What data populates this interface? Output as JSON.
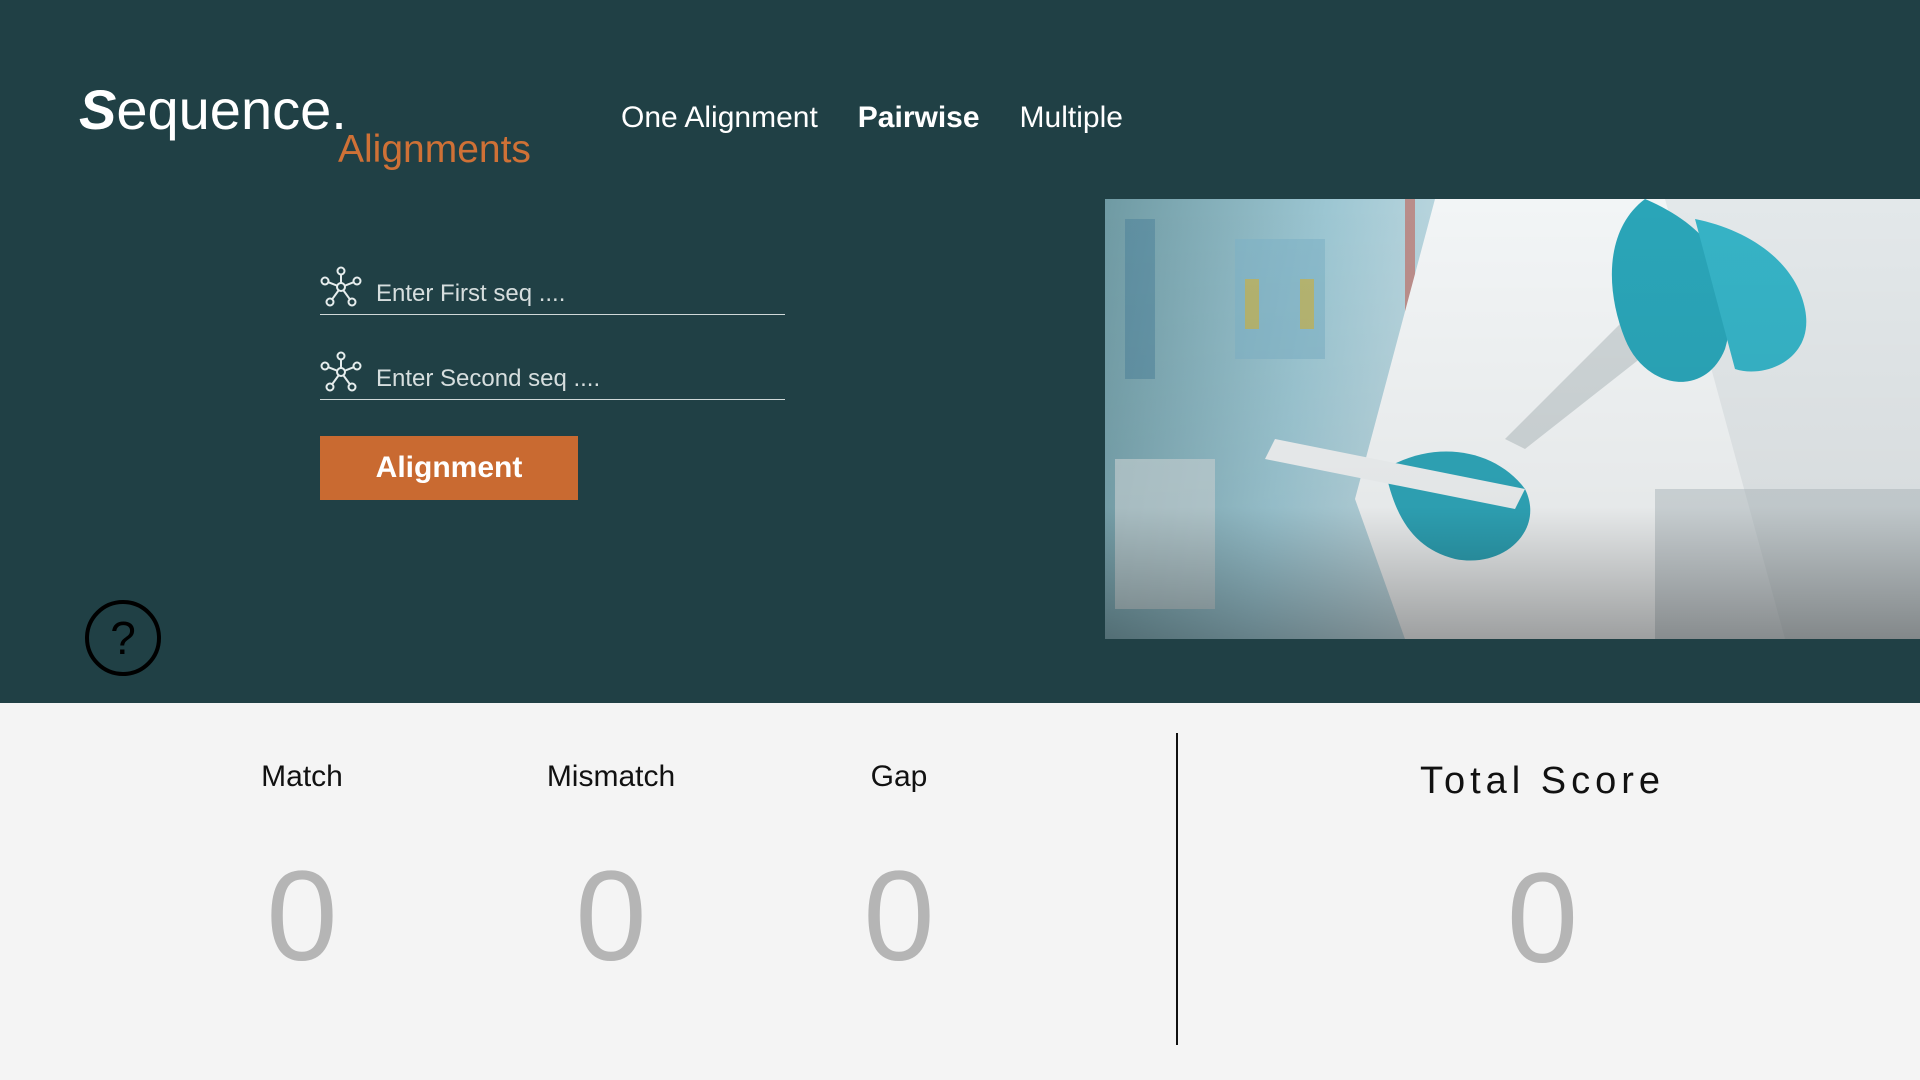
{
  "brand": {
    "title_initial": "S",
    "title_rest": "equence.",
    "subtitle": "Alignments"
  },
  "nav": {
    "items": [
      {
        "label": "One Alignment"
      },
      {
        "label": "Pairwise"
      },
      {
        "label": "Multiple"
      }
    ],
    "active": "Pairwise"
  },
  "form": {
    "first_seq": {
      "value": "",
      "placeholder": "Enter First seq ...."
    },
    "second_seq": {
      "value": "",
      "placeholder": "Enter Second seq ...."
    },
    "submit_label": "Alignment"
  },
  "help": {
    "glyph": "?"
  },
  "stats": {
    "match": {
      "label": "Match",
      "value": "0"
    },
    "mismatch": {
      "label": "Mismatch",
      "value": "0"
    },
    "gap": {
      "label": "Gap",
      "value": "0"
    }
  },
  "total": {
    "label": "Total Score",
    "value": "0"
  },
  "colors": {
    "hero_bg": "#204045",
    "accent": "#c96a31",
    "stats_bg": "#f4f4f4",
    "value_gray": "#b5b5b5"
  },
  "icons": {
    "field_icon": "molecule-icon",
    "help_icon": "question-circle-icon"
  }
}
